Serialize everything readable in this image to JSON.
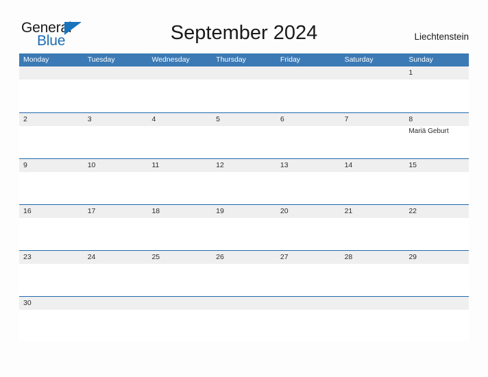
{
  "logo": {
    "word_top": "General",
    "word_bottom": "Blue",
    "color_top": "#1a1a1a",
    "color_bottom": "#1d6cb5",
    "flag_color": "#1874bd"
  },
  "header": {
    "title": "September 2024",
    "region": "Liechtenstein"
  },
  "colors": {
    "header_blue": "#3b7ab5",
    "row_divider_blue": "#1f67ad",
    "date_band_gray": "#efefef",
    "text_dark": "#2b2b2b",
    "page_background": "#fdfdfd"
  },
  "calendar": {
    "day_names": [
      "Monday",
      "Tuesday",
      "Wednesday",
      "Thursday",
      "Friday",
      "Saturday",
      "Sunday"
    ],
    "weeks": [
      {
        "days": [
          {
            "num": "",
            "events": []
          },
          {
            "num": "",
            "events": []
          },
          {
            "num": "",
            "events": []
          },
          {
            "num": "",
            "events": []
          },
          {
            "num": "",
            "events": []
          },
          {
            "num": "",
            "events": []
          },
          {
            "num": "1",
            "events": []
          }
        ]
      },
      {
        "days": [
          {
            "num": "2",
            "events": []
          },
          {
            "num": "3",
            "events": []
          },
          {
            "num": "4",
            "events": []
          },
          {
            "num": "5",
            "events": []
          },
          {
            "num": "6",
            "events": []
          },
          {
            "num": "7",
            "events": []
          },
          {
            "num": "8",
            "events": [
              "Mariä Geburt"
            ]
          }
        ]
      },
      {
        "days": [
          {
            "num": "9",
            "events": []
          },
          {
            "num": "10",
            "events": []
          },
          {
            "num": "11",
            "events": []
          },
          {
            "num": "12",
            "events": []
          },
          {
            "num": "13",
            "events": []
          },
          {
            "num": "14",
            "events": []
          },
          {
            "num": "15",
            "events": []
          }
        ]
      },
      {
        "days": [
          {
            "num": "16",
            "events": []
          },
          {
            "num": "17",
            "events": []
          },
          {
            "num": "18",
            "events": []
          },
          {
            "num": "19",
            "events": []
          },
          {
            "num": "20",
            "events": []
          },
          {
            "num": "21",
            "events": []
          },
          {
            "num": "22",
            "events": []
          }
        ]
      },
      {
        "days": [
          {
            "num": "23",
            "events": []
          },
          {
            "num": "24",
            "events": []
          },
          {
            "num": "25",
            "events": []
          },
          {
            "num": "26",
            "events": []
          },
          {
            "num": "27",
            "events": []
          },
          {
            "num": "28",
            "events": []
          },
          {
            "num": "29",
            "events": []
          }
        ]
      },
      {
        "days": [
          {
            "num": "30",
            "events": []
          },
          {
            "num": "",
            "events": []
          },
          {
            "num": "",
            "events": []
          },
          {
            "num": "",
            "events": []
          },
          {
            "num": "",
            "events": []
          },
          {
            "num": "",
            "events": []
          },
          {
            "num": "",
            "events": []
          }
        ]
      }
    ]
  }
}
